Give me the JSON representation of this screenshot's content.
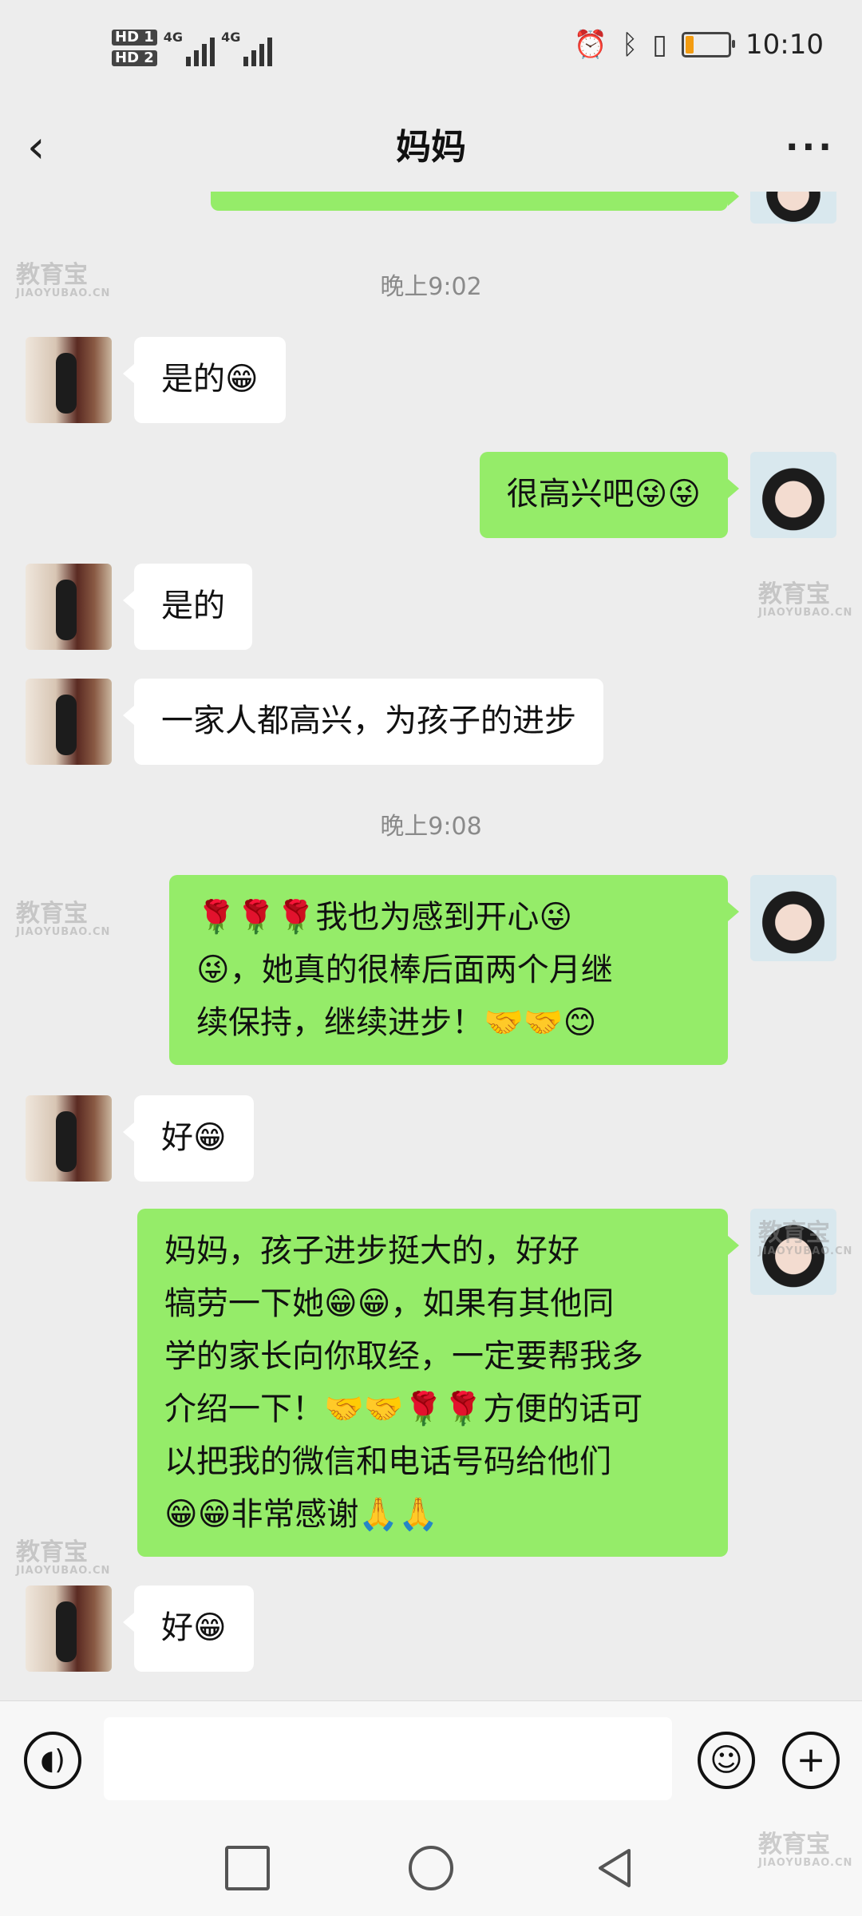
{
  "status_bar": {
    "sim1_label": "HD 1",
    "sim2_label": "HD 2",
    "network1": "4G",
    "network2": "4G",
    "time": "10:10",
    "icons": [
      "alarm-icon",
      "bluetooth-icon",
      "vibrate-icon",
      "battery-icon"
    ]
  },
  "header": {
    "back_icon": "chevron-left-icon",
    "title": "妈妈",
    "more_icon": "more-icon"
  },
  "messages": [
    {
      "type": "time",
      "text": "晚上9:02"
    },
    {
      "type": "in",
      "text": "是的😁"
    },
    {
      "type": "out",
      "text": "很高兴吧😜😜"
    },
    {
      "type": "in",
      "text": "是的"
    },
    {
      "type": "in",
      "text": "一家人都高兴，为孩子的进步"
    },
    {
      "type": "time",
      "text": "晚上9:08"
    },
    {
      "type": "out",
      "text": "🌹🌹🌹我也为感到开心😜\n😜，她真的很棒后面两个月继\n续保持，继续进步！🤝🤝😊"
    },
    {
      "type": "in",
      "text": "好😁"
    },
    {
      "type": "out",
      "text": "妈妈，孩子进步挺大的，好好\n犒劳一下她😁😁，如果有其他同\n学的家长向你取经，一定要帮我多\n介绍一下！🤝🤝🌹🌹方便的话可\n以把我的微信和电话号码给他们\n😁😁非常感谢🙏🙏"
    },
    {
      "type": "in",
      "text": "好😁"
    }
  ],
  "watermark": {
    "main": "教育宝",
    "sub": "JIAOYUBAO.CN"
  },
  "input_bar": {
    "voice_icon": "voice-icon",
    "text_value": "",
    "emoji_icon": "emoji-icon",
    "plus_icon": "plus-icon"
  },
  "system_nav": {
    "icons": [
      "recents-icon",
      "home-icon",
      "back-icon"
    ]
  },
  "colors": {
    "background": "#ededed",
    "outgoing_bubble": "#95ec69",
    "incoming_bubble": "#ffffff"
  }
}
